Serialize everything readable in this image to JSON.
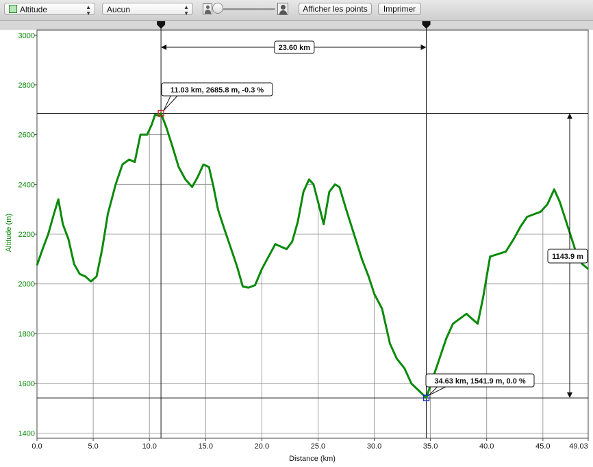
{
  "toolbar": {
    "profile_select": "Altitude",
    "overlay_select": "Aucun",
    "show_points_label": "Afficher les points",
    "print_label": "Imprimer",
    "zoom_level": 0.0
  },
  "colors": {
    "line": "#0a8a0a",
    "axis_text": "#0a8a0a",
    "grid": "#888888",
    "marker_start": "#d02020",
    "marker_end": "#2030c0"
  },
  "icons": [
    "person-small-icon",
    "person-large-icon",
    "marker-arrow-icon"
  ],
  "chart_data": {
    "type": "line",
    "xlabel": "Distance (km)",
    "ylabel": "Altitude (m)",
    "xlim": [
      0,
      49.03
    ],
    "ylim": [
      1380,
      3020
    ],
    "grid": true,
    "x_ticks": [
      "0.0",
      "5.0",
      "10.0",
      "15.0",
      "20.0",
      "25.0",
      "30.0",
      "35.0",
      "40.0",
      "45.0",
      "49.03"
    ],
    "y_ticks": [
      "1400",
      "1600",
      "1800",
      "2000",
      "2200",
      "2400",
      "2600",
      "2800",
      "3000"
    ],
    "series": [
      {
        "x": [
          0,
          0.5,
          1,
          1.5,
          1.9,
          2.3,
          2.8,
          3.3,
          3.8,
          4.3,
          4.8,
          5.3,
          5.8,
          6.3,
          7,
          7.6,
          8.2,
          8.7,
          9.2,
          9.8,
          10.2,
          10.5,
          10.9,
          11.03,
          11.5,
          12,
          12.6,
          13.2,
          13.8,
          14.3,
          14.8,
          15.3,
          15.7,
          16.1,
          16.6,
          17.2,
          17.8,
          18.3,
          18.8,
          19.4,
          20,
          20.6,
          21.2,
          21.7,
          22.2,
          22.7,
          23.2,
          23.7,
          24.2,
          24.6,
          25,
          25.5,
          26,
          26.5,
          26.9,
          27.5,
          28.2,
          28.9,
          29.5,
          30,
          30.7,
          31.4,
          32,
          32.7,
          33.3,
          34,
          34.63,
          35.2,
          35.8,
          36.4,
          37,
          37.6,
          38.2,
          38.7,
          39.2,
          39.7,
          40.3,
          41,
          41.7,
          42.4,
          43,
          43.6,
          44.2,
          44.8,
          45.4,
          46,
          46.5,
          47,
          47.5,
          48,
          48.5,
          49.03
        ],
        "y": [
          2075,
          2140,
          2200,
          2280,
          2340,
          2240,
          2180,
          2080,
          2040,
          2030,
          2010,
          2030,
          2140,
          2280,
          2400,
          2480,
          2500,
          2490,
          2600,
          2600,
          2640,
          2680,
          2675,
          2686,
          2630,
          2560,
          2470,
          2420,
          2390,
          2430,
          2480,
          2470,
          2390,
          2300,
          2230,
          2150,
          2070,
          1990,
          1985,
          1995,
          2060,
          2110,
          2160,
          2150,
          2140,
          2170,
          2250,
          2370,
          2420,
          2400,
          2330,
          2240,
          2370,
          2400,
          2390,
          2300,
          2200,
          2100,
          2030,
          1960,
          1900,
          1760,
          1700,
          1660,
          1600,
          1570,
          1542,
          1620,
          1700,
          1780,
          1840,
          1860,
          1880,
          1860,
          1840,
          1950,
          2110,
          2120,
          2130,
          2180,
          2230,
          2270,
          2280,
          2290,
          2320,
          2380,
          2330,
          2260,
          2190,
          2120,
          2080,
          2060
        ]
      }
    ],
    "annotations": {
      "start_marker_label": "11.03 km, 2685.8 m, -0.3 %",
      "end_marker_label": "34.63 km, 1541.9 m, 0.0 %",
      "distance_label": "23.60 km",
      "elevation_label": "1143.9 m",
      "start_marker": {
        "x": 11.03,
        "y": 2685.8
      },
      "end_marker": {
        "x": 34.63,
        "y": 1541.9
      }
    }
  }
}
